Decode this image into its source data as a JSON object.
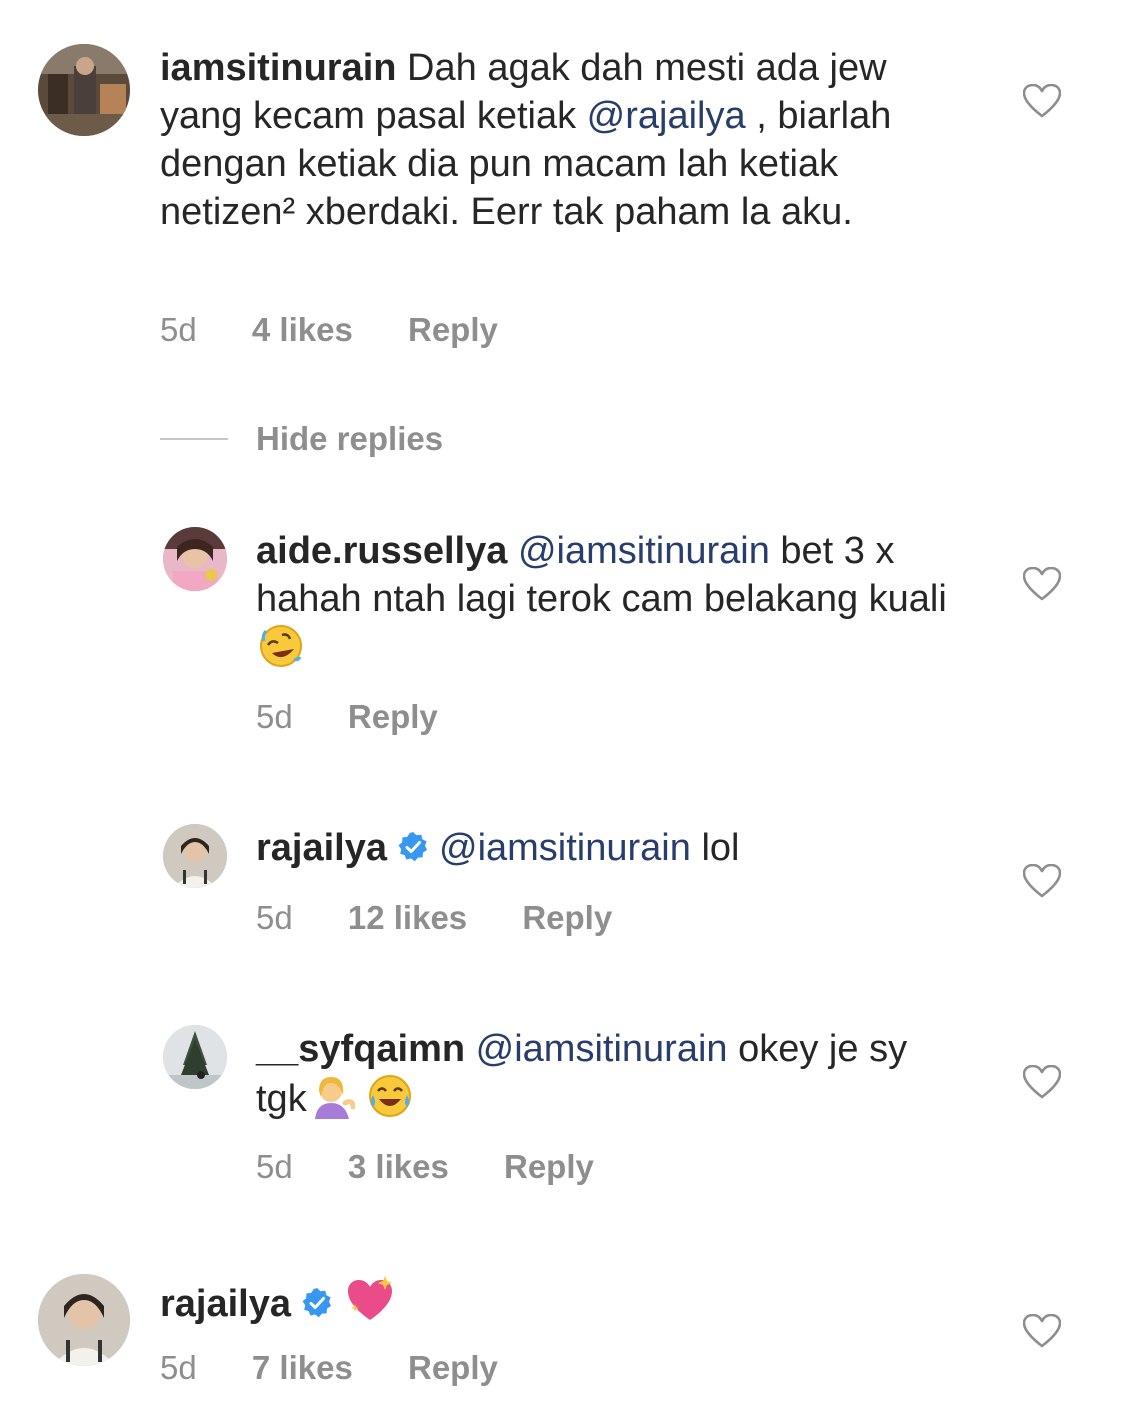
{
  "colors": {
    "text": "#262626",
    "secondary": "#8e8e8e",
    "mention": "#283d6b",
    "verified": "#3897f0",
    "divider": "#c7c7c7"
  },
  "comments": [
    {
      "username": "iamsitinurain",
      "verified": false,
      "text_before": " Dah agak dah mesti ada jew yang kecam pasal ketiak ",
      "mention": "@rajailya",
      "text_after": " , biarlah dengan ketiak dia pun macam lah ketiak netizen² xberdaki. Eerr tak paham la aku.",
      "time": "5d",
      "likes": "4 likes",
      "reply": "Reply"
    }
  ],
  "hide_replies": "Hide replies",
  "replies": [
    {
      "username": "aide.russellya",
      "verified": false,
      "mention": "@iamsitinurain",
      "text": " bet 3 x hahah ntah lagi terok cam belakang kuali ",
      "emojis": [
        "rolling-on-floor-laughing-emoji"
      ],
      "time": "5d",
      "likes": "",
      "reply": "Reply"
    },
    {
      "username": "rajailya",
      "verified": true,
      "mention": "@iamsitinurain",
      "text": " lol",
      "time": "5d",
      "likes": "12 likes",
      "reply": "Reply"
    },
    {
      "username": "__syfqaimn",
      "verified": false,
      "mention": "@iamsitinurain",
      "text": " okey je sy tgk",
      "emojis": [
        "person-tipping-hand-emoji",
        "tears-of-joy-emoji"
      ],
      "time": "5d",
      "likes": "3 likes",
      "reply": "Reply"
    }
  ],
  "last_comment": {
    "username": "rajailya",
    "verified": true,
    "emojis": [
      "sparkling-heart-emoji"
    ],
    "time": "5d",
    "likes": "7 likes",
    "reply": "Reply"
  },
  "icons": {
    "like": "heart-outline-icon",
    "verified": "verified-badge-icon"
  }
}
